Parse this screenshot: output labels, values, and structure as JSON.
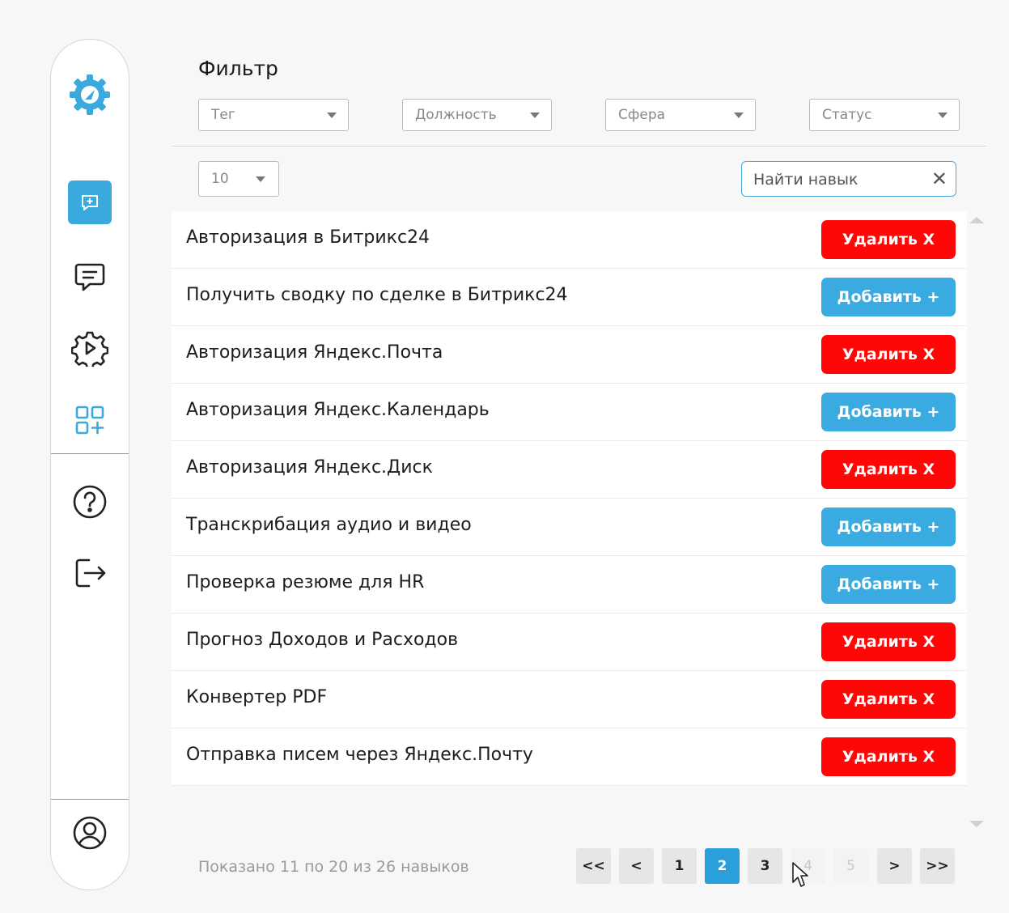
{
  "sidebar": {
    "icons": [
      "gear-logo-icon",
      "chat-plus-icon",
      "chat-icon",
      "gear-play-icon",
      "apps-add-icon",
      "help-icon",
      "logout-icon",
      "user-icon"
    ],
    "active_color": "#3aa9dd"
  },
  "filter": {
    "title": "Фильтр",
    "selects": {
      "tag": "Тег",
      "position": "Должность",
      "sphere": "Сфера",
      "status": "Статус"
    }
  },
  "per_page": "10",
  "search": {
    "placeholder": "Найти навык",
    "clear": "✕"
  },
  "skills": [
    {
      "name": "Авторизация в Битрикс24",
      "action": "Удалить X",
      "type": "delete"
    },
    {
      "name": "Получить сводку по сделке в Битрикс24",
      "action": "Добавить +",
      "type": "add"
    },
    {
      "name": "Авторизация Яндекс.Почта",
      "action": "Удалить X",
      "type": "delete"
    },
    {
      "name": "Авторизация Яндекс.Календарь",
      "action": "Добавить +",
      "type": "add"
    },
    {
      "name": "Авторизация Яндекс.Диск",
      "action": "Удалить X",
      "type": "delete"
    },
    {
      "name": "Транскрибация аудио и видео",
      "action": "Добавить +",
      "type": "add"
    },
    {
      "name": "Проверка резюме для HR",
      "action": "Добавить +",
      "type": "add"
    },
    {
      "name": "Прогноз Доходов и Расходов",
      "action": "Удалить X",
      "type": "delete"
    },
    {
      "name": "Конвертер PDF",
      "action": "Удалить X",
      "type": "delete"
    },
    {
      "name": "Отправка писем через Яндекс.Почту",
      "action": "Удалить X",
      "type": "delete"
    }
  ],
  "colors": {
    "delete": "#ff0707",
    "add": "#3aabe0",
    "page_active": "#2aa0db"
  },
  "pagination": {
    "summary": "Показано 11 по 20 из 26 навыков",
    "first": "<<",
    "prev": "<",
    "pages": [
      "1",
      "2",
      "3",
      "4",
      "5"
    ],
    "current": "2",
    "next": ">",
    "last": ">>"
  }
}
